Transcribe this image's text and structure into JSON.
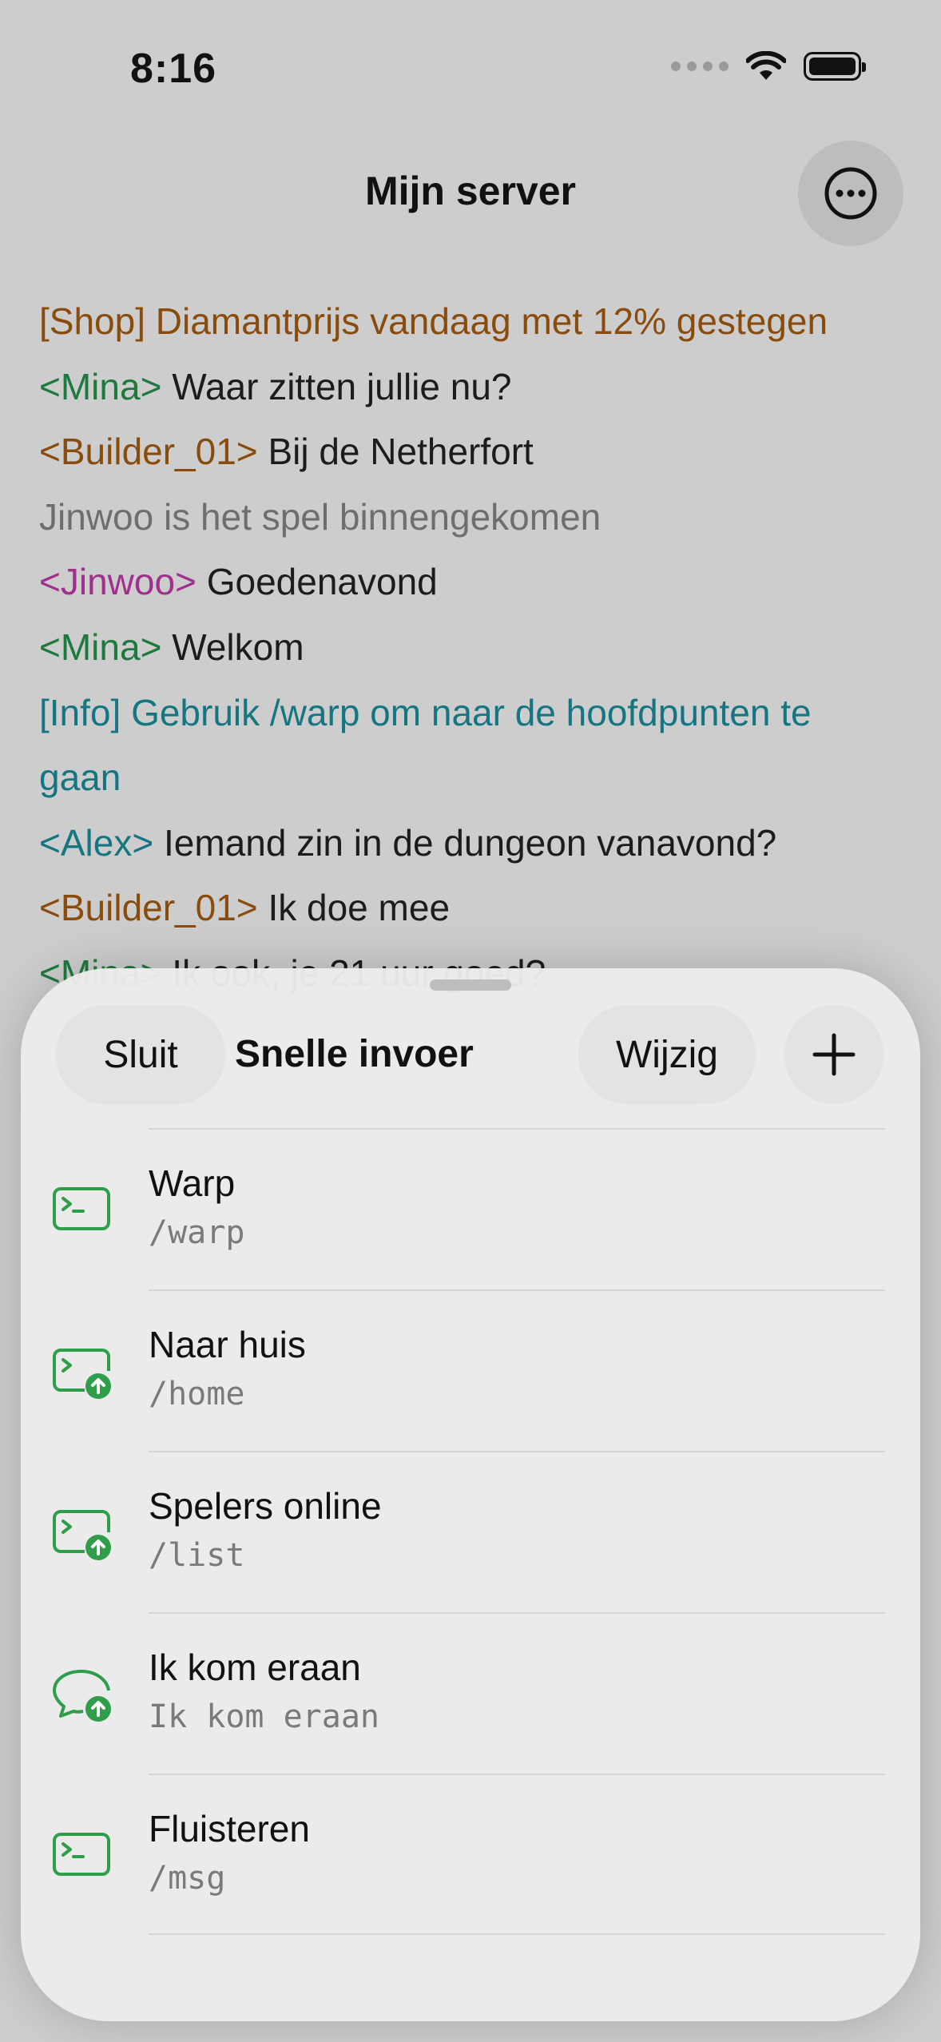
{
  "status_bar": {
    "time": "8:16"
  },
  "nav": {
    "title": "Mijn server",
    "more_icon": "ellipsis-circle-icon"
  },
  "chat": [
    {
      "prefix": "[Shop] Diamantprijs vandaag met 12% gestegen",
      "text": "",
      "prefix_color": "#8a4c0c"
    },
    {
      "prefix": "<Mina>",
      "text": " Waar zitten jullie nu?",
      "prefix_color": "#1e7a3c"
    },
    {
      "prefix": "<Builder_01>",
      "text": " Bij de Netherfort",
      "prefix_color": "#8a4c0c"
    },
    {
      "prefix": "Jinwoo is het spel binnengekomen",
      "text": "",
      "prefix_color": "#6e6e6e"
    },
    {
      "prefix": "<Jinwoo>",
      "text": " Goedenavond",
      "prefix_color": "#a0308e"
    },
    {
      "prefix": "<Mina>",
      "text": " Welkom",
      "prefix_color": "#1e7a3c"
    },
    {
      "prefix": "[Info] Gebruik /warp om naar de hoofdpunten te gaan",
      "text": "",
      "prefix_color": "#157682"
    },
    {
      "prefix": "<Alex>",
      "text": " Iemand zin in de dungeon vanavond?",
      "prefix_color": "#157682"
    },
    {
      "prefix": "<Builder_01>",
      "text": " Ik doe mee",
      "prefix_color": "#8a4c0c"
    },
    {
      "prefix": "<Mina>",
      "text": " Ik ook, je 21 uur goed?",
      "prefix_color": "#1e7a3c"
    }
  ],
  "sheet": {
    "close_label": "Sluit",
    "title": "Snelle invoer",
    "edit_label": "Wijzig",
    "add_icon": "plus-icon",
    "items": [
      {
        "title": "Warp",
        "command": "/warp",
        "icon": "terminal-icon"
      },
      {
        "title": "Naar huis",
        "command": "/home",
        "icon": "terminal-send-icon"
      },
      {
        "title": "Spelers online",
        "command": "/list",
        "icon": "terminal-send-icon"
      },
      {
        "title": "Ik kom eraan",
        "command": "Ik kom eraan",
        "icon": "chat-send-icon"
      },
      {
        "title": "Fluisteren",
        "command": "/msg",
        "icon": "terminal-icon"
      }
    ]
  },
  "colors": {
    "accent_green": "#2e9e4a"
  }
}
